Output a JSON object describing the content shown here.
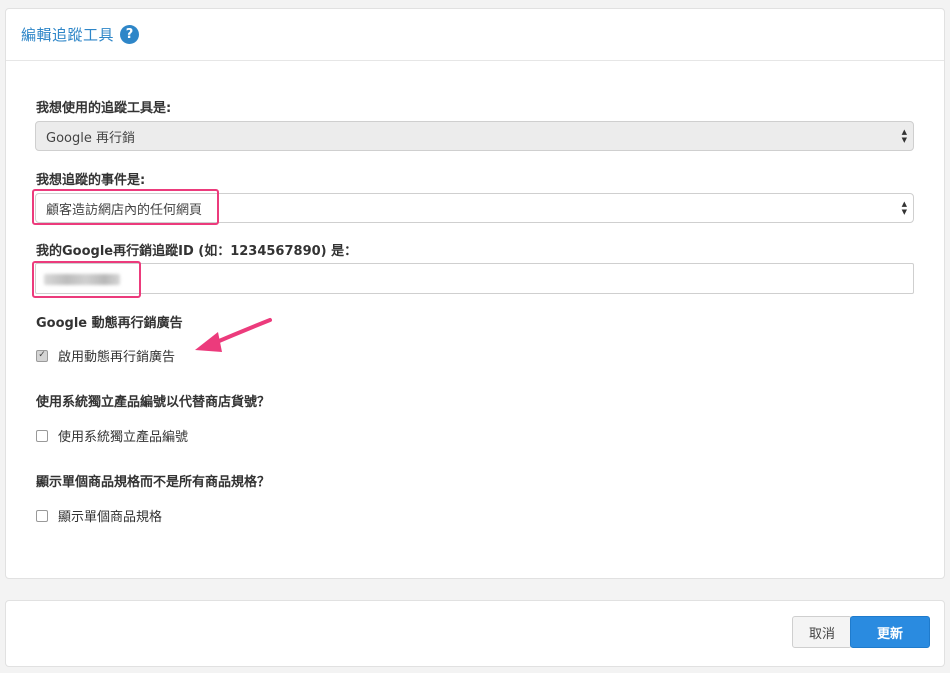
{
  "header": {
    "title": "編輯追蹤工具",
    "help_icon": "question-circle-icon"
  },
  "fields": {
    "tool": {
      "label": "我想使用的追蹤工具是:",
      "selected": "Google 再行銷"
    },
    "event": {
      "label": "我想追蹤的事件是:",
      "selected": "顧客造訪網店內的任何網頁"
    },
    "tracking_id": {
      "label": "我的Google再行銷追蹤ID (如：1234567890) 是："
    },
    "dynamic": {
      "heading": "Google 動態再行銷廣告",
      "checkbox_label": "啟用動態再行銷廣告",
      "checked": true
    },
    "system_id": {
      "heading": "使用系統獨立產品編號以代替商店貨號？",
      "checkbox_label": "使用系統獨立產品編號",
      "checked": false
    },
    "single_variant": {
      "heading": "顯示單個商品規格而不是所有商品規格？",
      "checkbox_label": "顯示單個商品規格",
      "checked": false
    }
  },
  "footer": {
    "cancel_label": "取消",
    "update_label": "更新"
  },
  "colors": {
    "accent": "#2e86c8",
    "primary_button": "#2a8be0",
    "annotation": "#ec3b7c"
  }
}
